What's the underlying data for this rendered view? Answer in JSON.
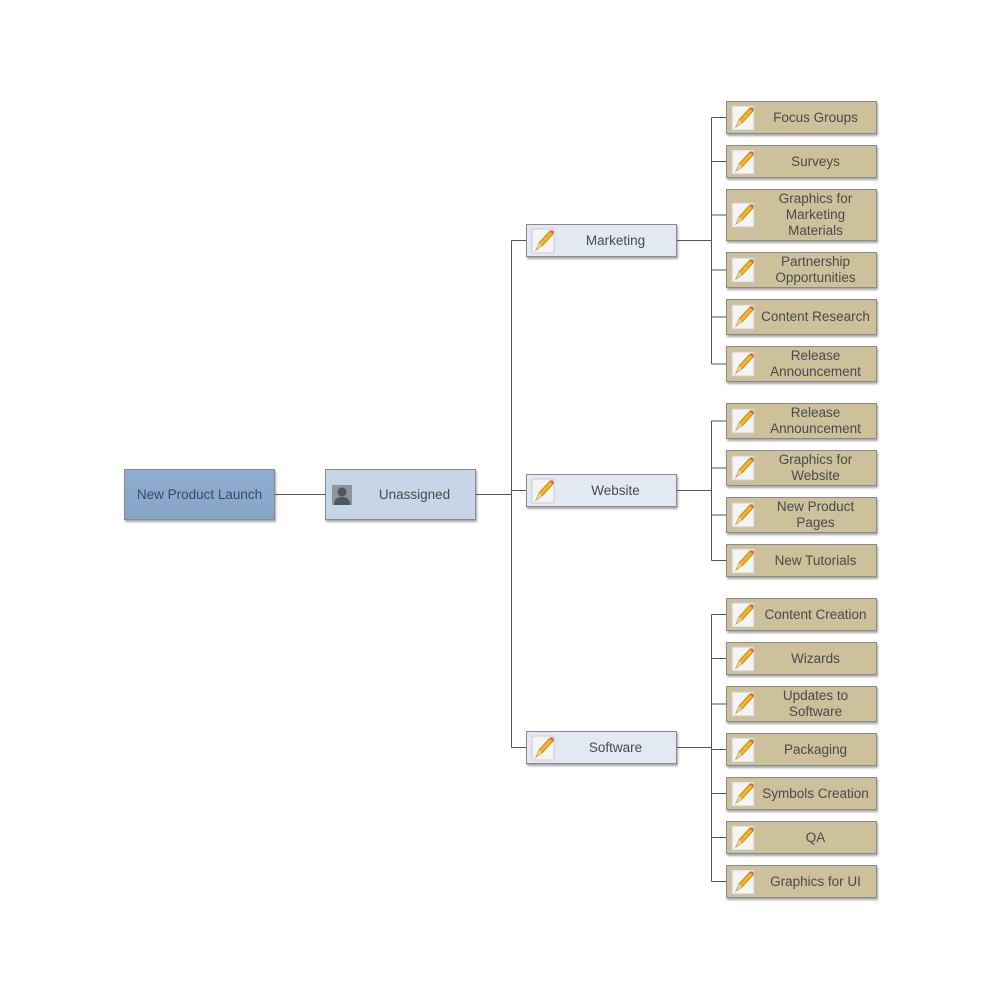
{
  "root": {
    "label": "New Product Launch"
  },
  "assignee": {
    "label": "Unassigned",
    "icon": "person-icon"
  },
  "branches": [
    {
      "label": "Marketing",
      "icon": "pencil-icon",
      "children": [
        "Focus Groups",
        "Surveys",
        "Graphics for Marketing Materials",
        "Partnership Opportunities",
        "Content Research",
        "Release Announcement"
      ]
    },
    {
      "label": "Website",
      "icon": "pencil-icon",
      "children": [
        "Release Announcement",
        "Graphics for Website",
        "New Product Pages",
        "New Tutorials"
      ]
    },
    {
      "label": "Software",
      "icon": "pencil-icon",
      "children": [
        "Content Creation",
        "Wizards",
        "Updates to Software",
        "Packaging",
        "Symbols Creation",
        "QA",
        "Graphics for UI"
      ]
    }
  ],
  "colors": {
    "root": "#8aa8cc",
    "assignee": "#c6d6e6",
    "branch": "#e2e9f3",
    "task": "#cdc19c",
    "connector": "#555555"
  }
}
